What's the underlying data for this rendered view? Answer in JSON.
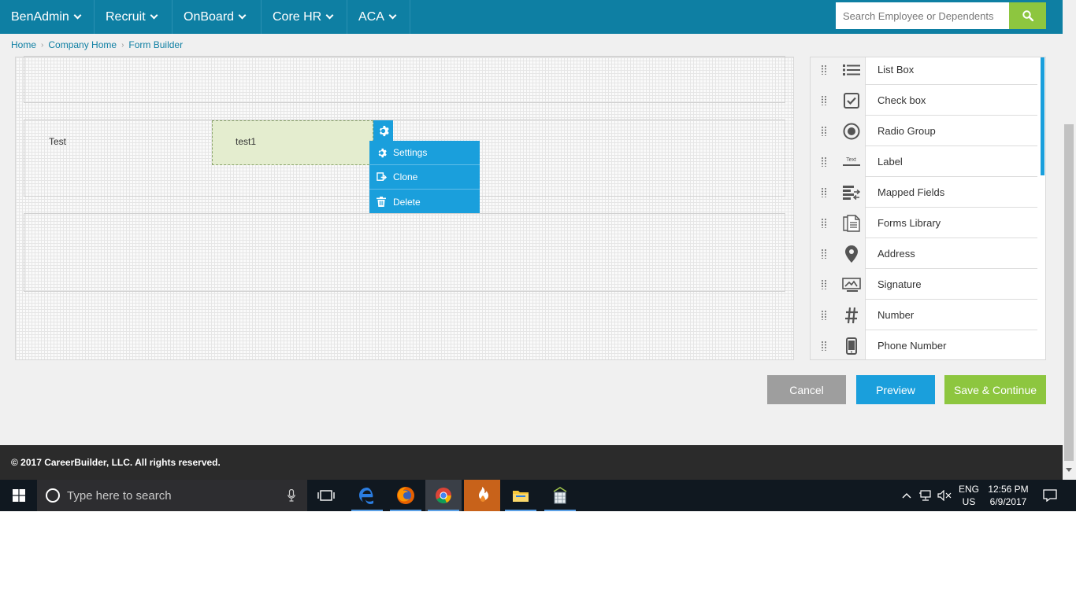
{
  "nav": {
    "items": [
      {
        "label": "BenAdmin"
      },
      {
        "label": "Recruit"
      },
      {
        "label": "OnBoard"
      },
      {
        "label": "Core HR"
      },
      {
        "label": "ACA"
      }
    ],
    "search_placeholder": "Search Employee or Dependents"
  },
  "breadcrumb": [
    "Home",
    "Company Home",
    "Form Builder"
  ],
  "canvas": {
    "field_label": "Test",
    "selected_field_value": "test1",
    "context_menu": [
      "Settings",
      "Clone",
      "Delete"
    ]
  },
  "field_panel": {
    "items": [
      {
        "label": "List Box",
        "icon": "list-icon"
      },
      {
        "label": "Check box",
        "icon": "checkbox-icon"
      },
      {
        "label": "Radio Group",
        "icon": "radio-icon"
      },
      {
        "label": "Label",
        "icon": "label-icon",
        "icon_text": "Text"
      },
      {
        "label": "Mapped Fields",
        "icon": "mapped-fields-icon"
      },
      {
        "label": "Forms Library",
        "icon": "document-icon"
      },
      {
        "label": "Address",
        "icon": "map-pin-icon"
      },
      {
        "label": "Signature",
        "icon": "signature-icon"
      },
      {
        "label": "Number",
        "icon": "hash-icon"
      },
      {
        "label": "Phone Number",
        "icon": "phone-icon"
      }
    ]
  },
  "actions": {
    "cancel": "Cancel",
    "preview": "Preview",
    "save": "Save & Continue"
  },
  "footer": {
    "copyright": "© 2017 CareerBuilder, LLC. All rights reserved."
  },
  "taskbar": {
    "search_placeholder": "Type here to search",
    "language": "ENG",
    "region": "US",
    "time": "12:56 PM",
    "date": "6/9/2017"
  },
  "colors": {
    "nav_bg": "#0e7fa3",
    "accent_blue": "#1a9fdc",
    "accent_green": "#8dc63f",
    "cancel_gray": "#9e9e9e",
    "footer_bg": "#2b2b2b"
  }
}
